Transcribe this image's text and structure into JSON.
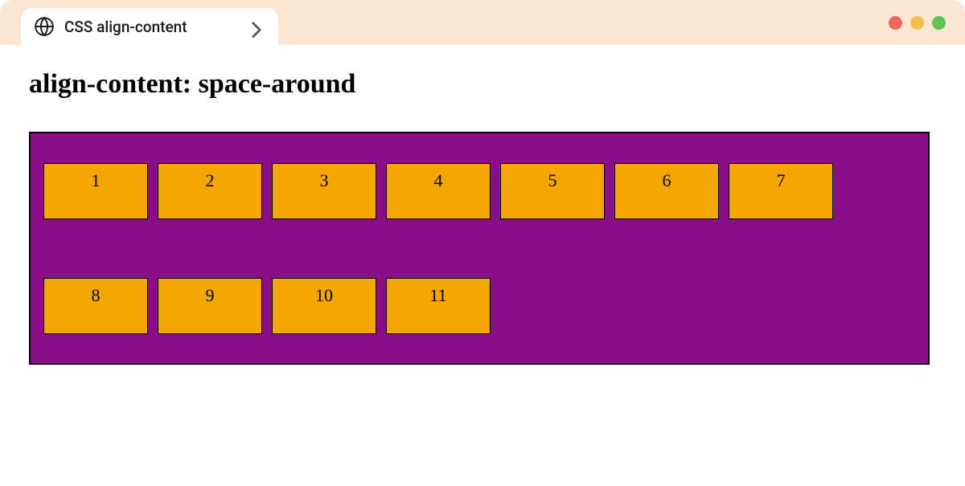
{
  "tab": {
    "title": "CSS align-content"
  },
  "page": {
    "heading": "align-content: space-around"
  },
  "items": {
    "0": "1",
    "1": "2",
    "2": "3",
    "3": "4",
    "4": "5",
    "5": "6",
    "6": "7",
    "7": "8",
    "8": "9",
    "9": "10",
    "10": "11"
  },
  "colors": {
    "titlebar": "#fce6d1",
    "container_bg": "#8a0e8a",
    "item_bg": "#f5a500",
    "red": "#ec6a5e",
    "yellow": "#f4be4f",
    "green": "#61c554"
  }
}
